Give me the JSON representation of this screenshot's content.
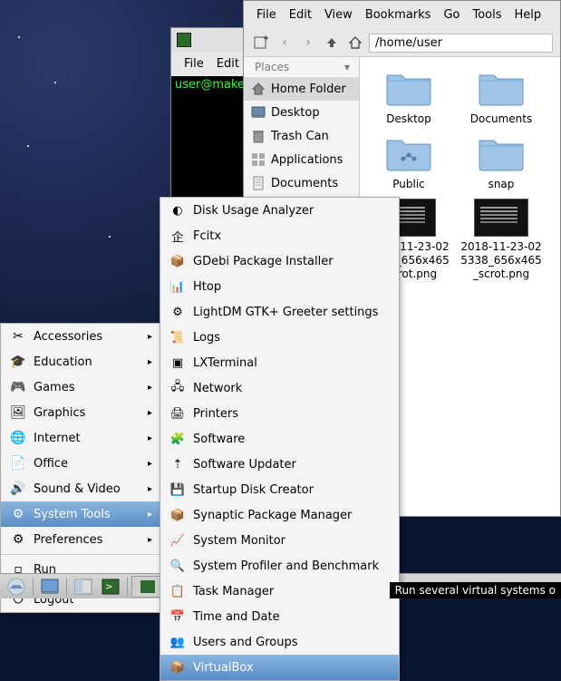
{
  "file_manager": {
    "menubar": [
      "File",
      "Edit",
      "View",
      "Bookmarks",
      "Go",
      "Tools",
      "Help"
    ],
    "path": "/home/user",
    "places_header": "Places",
    "places": [
      {
        "label": "Home Folder",
        "selected": true
      },
      {
        "label": "Desktop"
      },
      {
        "label": "Trash Can"
      },
      {
        "label": "Applications"
      },
      {
        "label": "Documents"
      }
    ],
    "folders": [
      "Desktop",
      "Documents",
      "Public",
      "snap"
    ],
    "screenshots": [
      "2018-11-23-025036_656x465_scrot.png",
      "2018-11-23-025338_656x465_scrot.png"
    ]
  },
  "terminal": {
    "menubar": [
      "File",
      "Edit"
    ],
    "prompt": "user@maket"
  },
  "menu_categories": [
    {
      "label": "Accessories",
      "has_sub": true
    },
    {
      "label": "Education",
      "has_sub": true
    },
    {
      "label": "Games",
      "has_sub": true
    },
    {
      "label": "Graphics",
      "has_sub": true
    },
    {
      "label": "Internet",
      "has_sub": true
    },
    {
      "label": "Office",
      "has_sub": true
    },
    {
      "label": "Sound & Video",
      "has_sub": true
    },
    {
      "label": "System Tools",
      "has_sub": true,
      "selected": true
    },
    {
      "label": "Preferences",
      "has_sub": true
    },
    {
      "label": "Run"
    },
    {
      "label": "Logout"
    }
  ],
  "system_tools": [
    "Disk Usage Analyzer",
    "Fcitx",
    "GDebi Package Installer",
    "Htop",
    "LightDM GTK+ Greeter settings",
    "Logs",
    "LXTerminal",
    "Network",
    "Printers",
    "Software",
    "Software Updater",
    "Startup Disk Creator",
    "Synaptic Package Manager",
    "System Monitor",
    "System Profiler and Benchmark",
    "Task Manager",
    "Time and Date",
    "Users and Groups",
    "VirtualBox"
  ],
  "tooltip": "Run several virtual systems o"
}
